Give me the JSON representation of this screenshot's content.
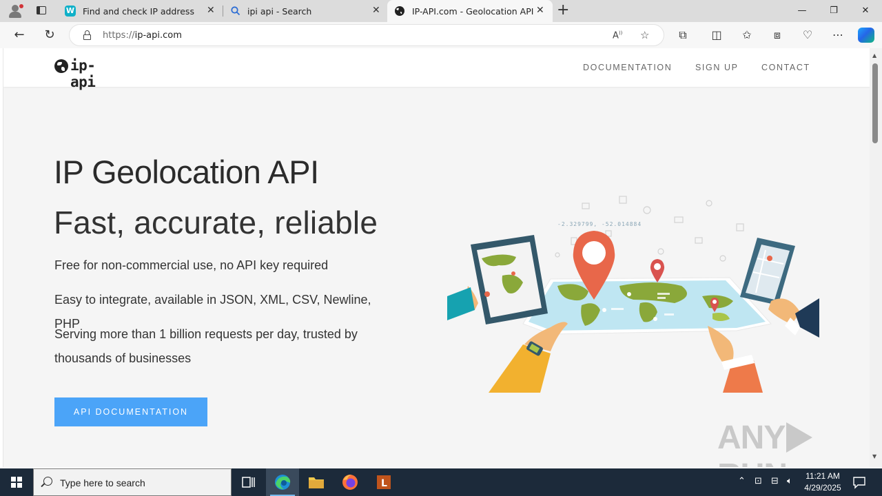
{
  "browser": {
    "tabs": [
      {
        "title": "Find and check IP address",
        "favicon": "w-app-icon",
        "active": false
      },
      {
        "title": "ipi api - Search",
        "favicon": "search-icon",
        "active": false
      },
      {
        "title": "IP-API.com - Geolocation API",
        "favicon": "globe-icon",
        "active": true
      }
    ],
    "url_proto": "https://",
    "url_host": "ip-api.com"
  },
  "site": {
    "logo_text": "ip-api",
    "nav": [
      "DOCUMENTATION",
      "SIGN UP",
      "CONTACT"
    ],
    "hero_title": "IP Geolocation API",
    "hero_subtitle": "Fast, accurate, reliable",
    "features": [
      "Free for non-commercial use, no API key required",
      "Easy to integrate, available in JSON, XML, CSV, Newline, PHP",
      "Serving more than 1 billion requests per day, trusted by thousands of businesses"
    ],
    "cta_label": "API DOCUMENTATION",
    "illustration_coords": "-2.329799, -52.014884"
  },
  "watermark": {
    "left": "ANY",
    "right": "RUN"
  },
  "taskbar": {
    "search_placeholder": "Type here to search",
    "time": "11:21 AM",
    "date": "4/29/2025"
  },
  "colors": {
    "accent_button": "#4ba4f8",
    "taskbar": "#1c2a3a",
    "map_sea": "#bfe6f2",
    "map_land": "#8aa83a",
    "pin": "#e8674a"
  }
}
